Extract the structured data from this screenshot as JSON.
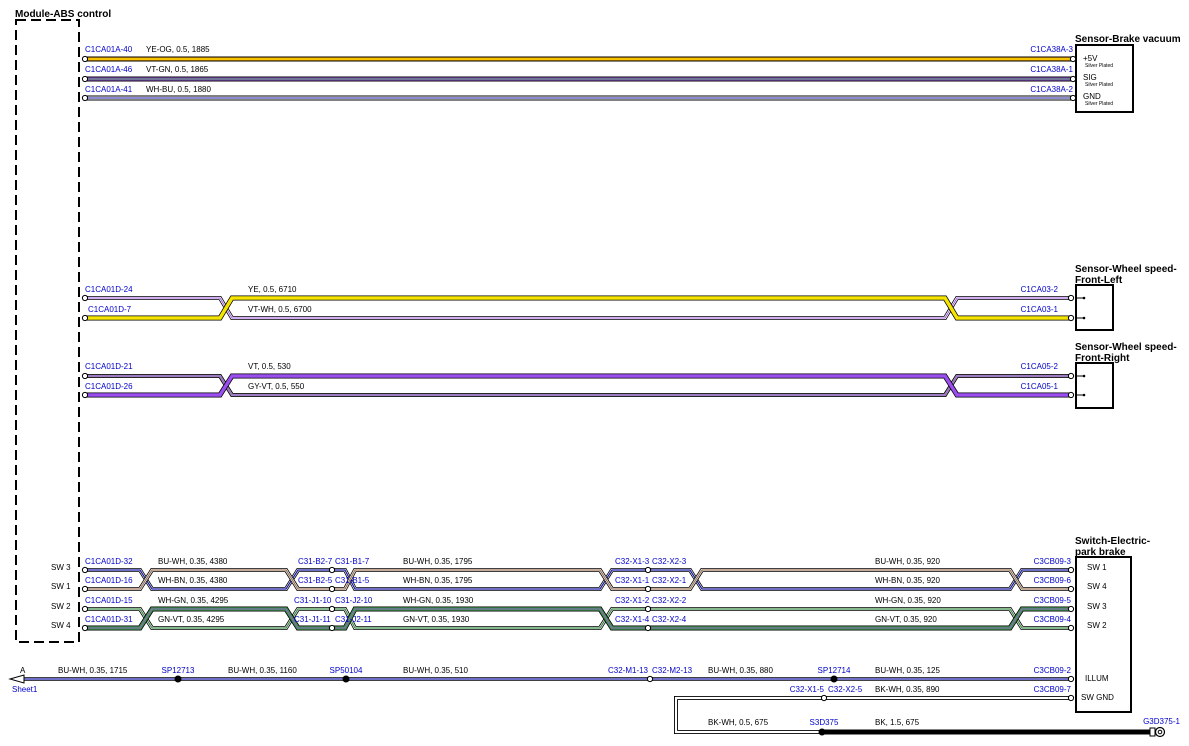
{
  "modules": {
    "abs": "Module-ABS control",
    "vacuum": "Sensor-Brake vacuum",
    "wsl": [
      "Sensor-Wheel speed-",
      "Front-Left"
    ],
    "wsr": [
      "Sensor-Wheel speed-",
      "Front-Right"
    ],
    "epb": [
      "Switch-Electric-",
      "park brake"
    ]
  },
  "vacuum_pins": [
    {
      "name": "+5V",
      "note": "Silver Plated"
    },
    {
      "name": "SIG",
      "note": "Silver Plated"
    },
    {
      "name": "GND",
      "note": "Silver Plated"
    }
  ],
  "wires": {
    "v1": {
      "from": "C1CA01A-40",
      "label": "YE-OG,  0.5,  1885",
      "to": "C1CA38A-3",
      "color": "#f5a500"
    },
    "v2": {
      "from": "C1CA01A-46",
      "label": "VT-GN,  0.5,  1865",
      "to": "C1CA38A-1",
      "color": "#a35ee8"
    },
    "v3": {
      "from": "C1CA01A-41",
      "label": "WH-BU,  0.5,  1880",
      "to": "C1CA38A-2",
      "color": "#1a1aa6"
    },
    "fl1": {
      "from": "C1CA01D-24",
      "label": "YE,  0.5,  6710",
      "to": "C1CA03-2",
      "color": "#f5e400"
    },
    "fl2": {
      "from": "C1CA01D-7",
      "label": "VT-WH,  0.5,  6700",
      "to": "C1CA03-1",
      "color": "#a35ee8"
    },
    "fr1": {
      "from": "C1CA01D-21",
      "label": "VT,  0.5,  530",
      "to": "C1CA05-2",
      "color": "#9a4ef0"
    },
    "fr2": {
      "from": "C1CA01D-26",
      "label": "GY-VT,  0.5,  550",
      "to": "C1CA05-1",
      "color": "#9a9a9a"
    }
  },
  "sw_labels_left": [
    "SW 3",
    "SW 1",
    "SW 2",
    "SW 4"
  ],
  "sw_labels_right": [
    "SW 1",
    "SW 4",
    "SW 3",
    "SW 2",
    "ILLUM",
    "SW GND"
  ],
  "sw_rows": [
    {
      "p0": "C1CA01D-32",
      "l1": "BU-WH,  0.35,  4380",
      "p1": "C31-B2-7",
      "p2": "C31-B1-7",
      "l2": "BU-WH,  0.35,  1795",
      "p3": "C32-X1-3",
      "p4": "C32-X2-3",
      "l3": "BU-WH,  0.35,  920",
      "p5": "C3CB09-3"
    },
    {
      "p0": "C1CA01D-16",
      "l1": "WH-BN,  0.35,  4380",
      "p1": "C31-B2-5",
      "p2": "C31-B1-5",
      "l2": "WH-BN,  0.35,  1795",
      "p3": "C32-X1-1",
      "p4": "C32-X2-1",
      "l3": "WH-BN,  0.35,  920",
      "p5": "C3CB09-6"
    },
    {
      "p0": "C1CA01D-15",
      "l1": "WH-GN,  0.35,  4295",
      "p1": "C31-J1-10",
      "p2": "C31-J2-10",
      "l2": "WH-GN,  0.35,  1930",
      "p3": "C32-X1-2",
      "p4": "C32-X2-2",
      "l3": "WH-GN,  0.35,  920",
      "p5": "C3CB09-5"
    },
    {
      "p0": "C1CA01D-31",
      "l1": "GN-VT,  0.35,  4295",
      "p1": "C31-J1-11",
      "p2": "C31-J2-11",
      "l2": "GN-VT,  0.35,  1930",
      "p3": "C32-X1-4",
      "p4": "C32-X2-4",
      "l3": "GN-VT,  0.35,  920",
      "p5": "C3CB09-4"
    }
  ],
  "illum": {
    "sheet_letter": "A",
    "sheet_name": "Sheet1",
    "seg_labels": [
      "BU-WH,  0.35,  1715",
      "BU-WH,  0.35,  1160",
      "BU-WH,  0.35,  510",
      "BU-WH,  0.35,  880",
      "BU-WH,  0.35,  125"
    ],
    "splices": [
      "SP12713",
      "SP50104",
      "SP12714"
    ],
    "conn_a": "C32-M1-13",
    "conn_b": "C32-M2-13",
    "end": "C3CB09-2"
  },
  "gnd": {
    "conn_a": "C32-X1-5",
    "conn_b": "C32-X2-5",
    "label_top": "BK-WH,  0.35,  890",
    "end": "C3CB09-7",
    "label_low1": "BK-WH,  0.5,  675",
    "splice": "S3D375",
    "label_low2": "BK,  1.5,  675",
    "ground": "G3D375-1"
  },
  "colors": {
    "pin_blue": "#0000cc",
    "yellow": "#f5e400",
    "orange": "#f5a500",
    "violet": "#9a4ef0",
    "navy": "#1a1aa6",
    "brown": "#a0785a",
    "green": "#3f8f4a",
    "gray": "#9a9a9a"
  }
}
